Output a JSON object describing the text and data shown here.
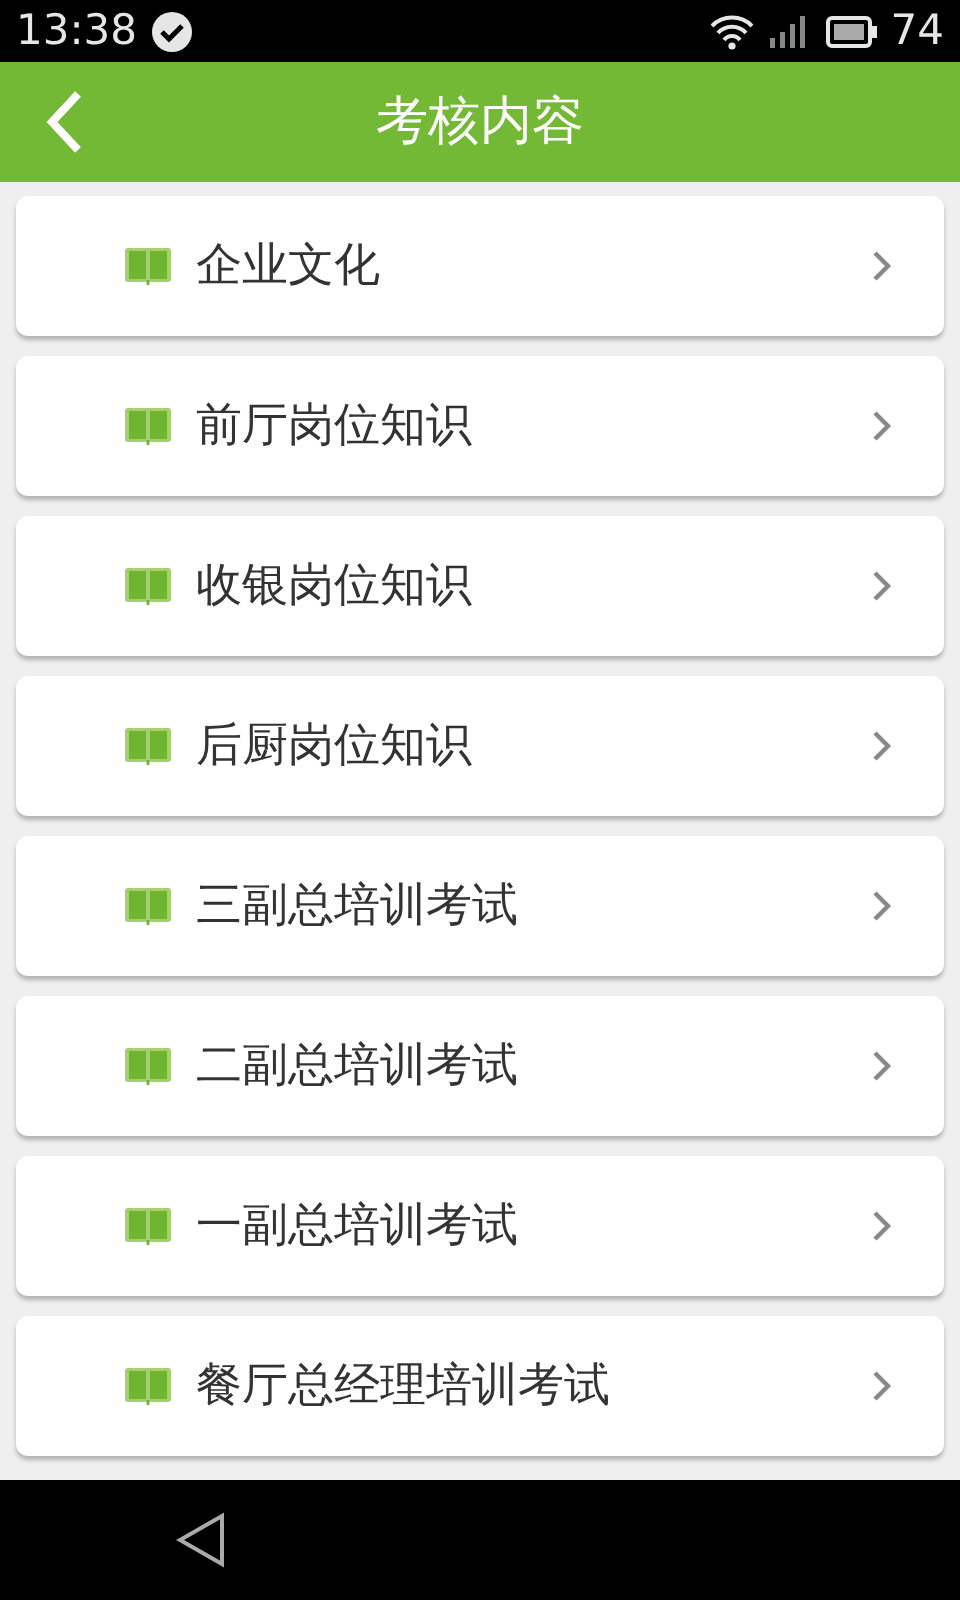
{
  "status_bar": {
    "time": "13:38",
    "battery": "74"
  },
  "header": {
    "title": "考核内容"
  },
  "items": [
    {
      "label": "企业文化"
    },
    {
      "label": "前厅岗位知识"
    },
    {
      "label": "收银岗位知识"
    },
    {
      "label": "后厨岗位知识"
    },
    {
      "label": "三副总培训考试"
    },
    {
      "label": "二副总培训考试"
    },
    {
      "label": "一副总培训考试"
    },
    {
      "label": "餐厅总经理培训考试"
    }
  ]
}
